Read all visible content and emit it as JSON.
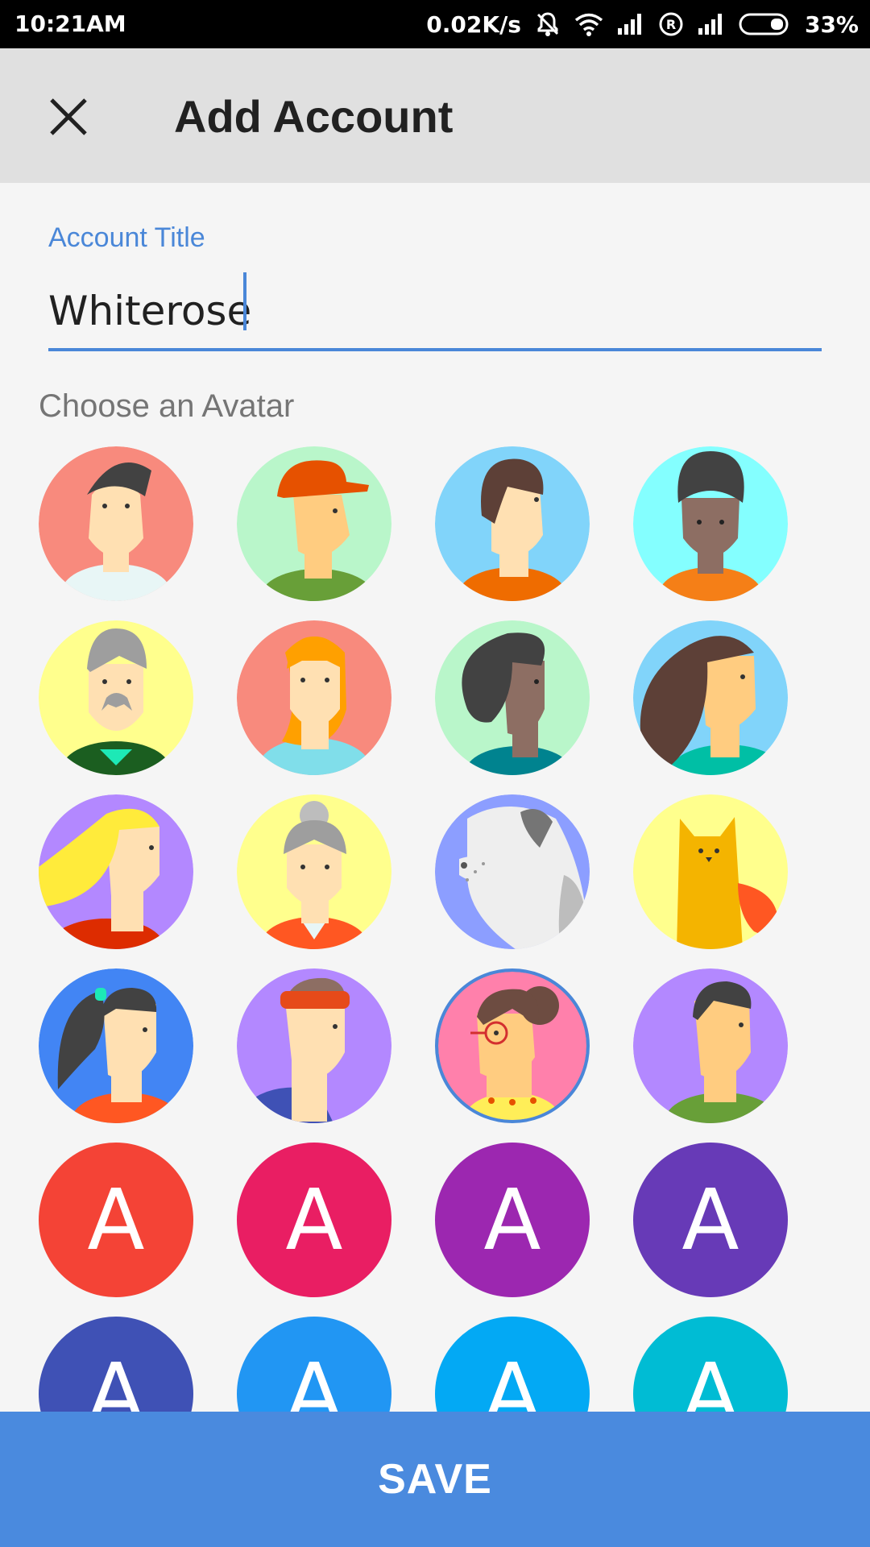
{
  "status_bar": {
    "time": "10:21AM",
    "net_speed": "0.02K/s",
    "battery": "33%",
    "icons": [
      "mute-icon",
      "wifi-icon",
      "signal-icon",
      "roaming-icon",
      "signal-icon",
      "battery-icon"
    ]
  },
  "app_bar": {
    "close_icon": "close-icon",
    "title": "Add Account"
  },
  "form": {
    "label": "Account Title",
    "value": "Whiterose"
  },
  "avatar_section": {
    "label": "Choose an Avatar",
    "selected": "avatar-glasses-bun",
    "letter": "A",
    "colors": {
      "red": "#f44336",
      "pink": "#e91e63",
      "purple": "#9c27b0",
      "deep_purple": "#673ab7",
      "indigo": "#3f51b5",
      "blue": "#2196f3",
      "light_blue": "#03a9f4",
      "cyan": "#00bcd4"
    }
  },
  "save": {
    "label": "SAVE"
  },
  "accent_color": "#4a87d8"
}
